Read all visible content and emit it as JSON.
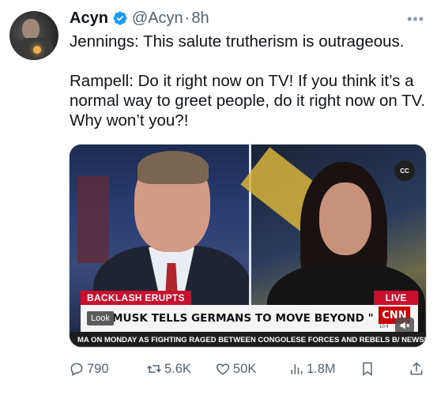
{
  "author": {
    "name": "Acyn",
    "handle": "@Acyn",
    "separator": "·",
    "time": "8h",
    "verified_icon": "verified-badge-icon",
    "verified_color": "#1d9bf0"
  },
  "more_icon": "more-icon",
  "tweet": {
    "line1": "Jennings: This salute trutherism is outrageous.",
    "line2": "Rampell: Do it right now on TV! If you think it’s a normal way to greet people, do it right now on TV. Why won’t you?!"
  },
  "video": {
    "cc_label": "CC",
    "tag_left": "BACKLASH ERUPTS",
    "tag_right": "LIVE",
    "look_badge": "Look",
    "headline": "MUSK TELLS GERMANS TO MOVE BEYOND \"PAST GUILT\"",
    "network_logo": "CNN",
    "clock": "10:4",
    "ticker": "MA ON MONDAY AS FIGHTING RAGED BETWEEN CONGOLESE FORCES AND REBELS B/ NEWSNIGHT",
    "brand_red": "#cc0000"
  },
  "actions": {
    "replies": "790",
    "reposts": "5.6K",
    "likes": "50K",
    "views": "1.8M"
  }
}
